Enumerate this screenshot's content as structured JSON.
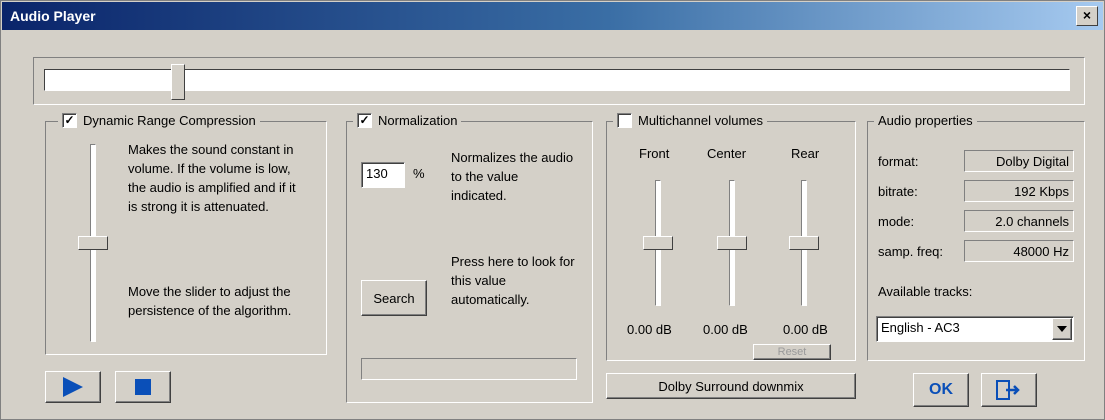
{
  "window": {
    "title": "Audio Player",
    "close_glyph": "×"
  },
  "seek": {
    "position_fraction": 0.12
  },
  "drc": {
    "checked": true,
    "label": "Dynamic Range Compression",
    "description": "Makes the sound constant in volume. If the volume is low, the audio is amplified and if it is strong it is attenuated.",
    "hint": "Move the slider to adjust the persistence of the algorithm."
  },
  "normalization": {
    "checked": true,
    "label": "Normalization",
    "value": "130",
    "unit": "%",
    "description": "Normalizes the audio to the value indicated.",
    "search_hint": "Press here to look for this value automatically.",
    "search_label": "Search"
  },
  "multichannel": {
    "checked": false,
    "label": "Multichannel volumes",
    "channels": [
      {
        "name": "Front",
        "value": "0.00 dB"
      },
      {
        "name": "Center",
        "value": "0.00 dB"
      },
      {
        "name": "Rear",
        "value": "0.00 dB"
      }
    ],
    "reset_label": "Reset",
    "downmix_label": "Dolby Surround downmix"
  },
  "properties": {
    "title": "Audio properties",
    "rows": [
      {
        "label": "format:",
        "value": "Dolby Digital"
      },
      {
        "label": "bitrate:",
        "value": "192 Kbps"
      },
      {
        "label": "mode:",
        "value": "2.0 channels"
      },
      {
        "label": "samp. freq:",
        "value": "48000 Hz"
      }
    ],
    "tracks_label": "Available tracks:",
    "selected_track": "English - AC3"
  },
  "controls": {
    "play_icon": "play-icon",
    "stop_icon": "stop-icon"
  },
  "footer": {
    "ok_label": "OK",
    "exit_icon": "exit-icon"
  },
  "colors": {
    "title_start": "#0a246a",
    "title_end": "#a6caf0",
    "face": "#d4d0c8",
    "accent": "#0a4fb8"
  }
}
